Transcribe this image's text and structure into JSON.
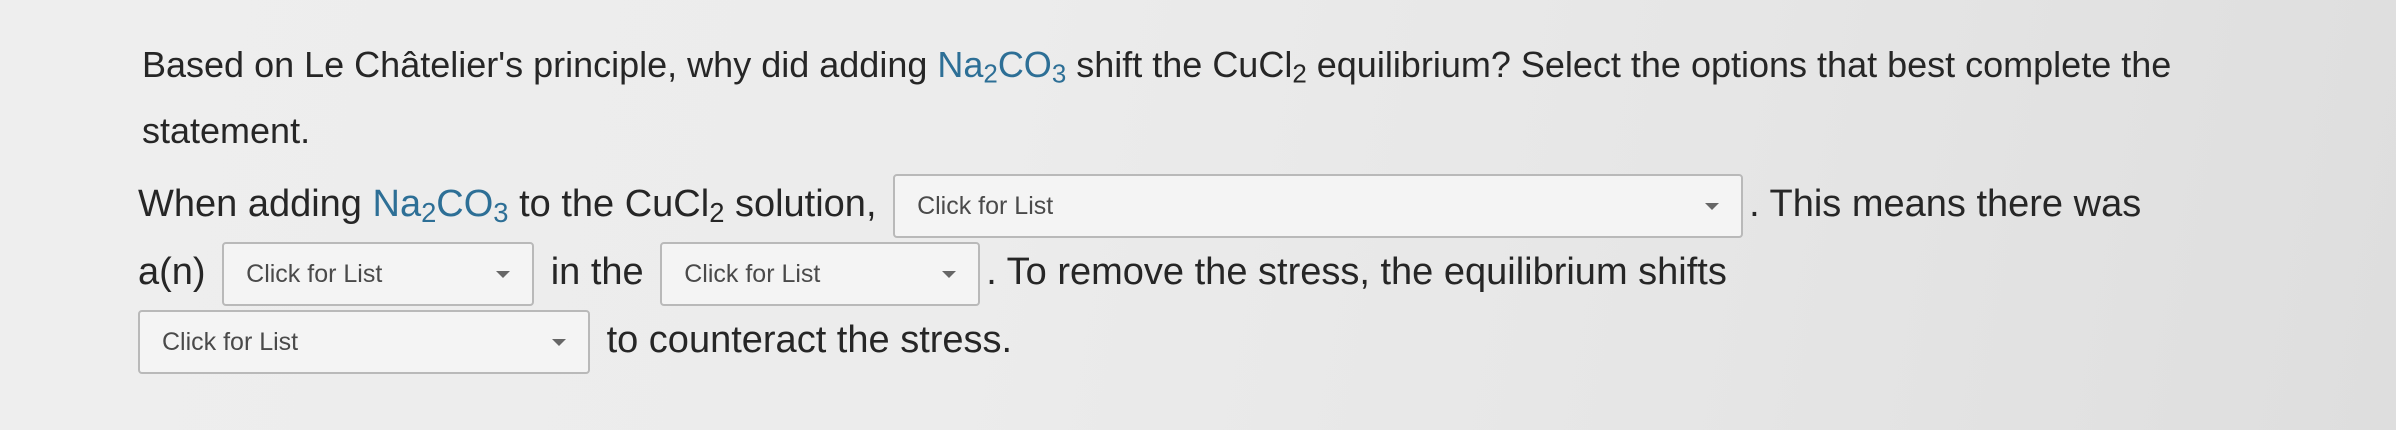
{
  "question": {
    "part1": "Based on Le Châtelier's principle, why did adding ",
    "chem1": {
      "a": "Na",
      "s1": "2",
      "b": "CO",
      "s2": "3"
    },
    "part2": " shift the ",
    "chem2": {
      "a": "CuCl",
      "s1": "2"
    },
    "part3": " equilibrium? Select the options that best complete the statement."
  },
  "statement": {
    "t1": "When adding ",
    "chemA": {
      "a": "Na",
      "s1": "2",
      "b": "CO",
      "s2": "3"
    },
    "t2": " to the ",
    "chemB": {
      "a": "CuCl",
      "s1": "2"
    },
    "t3": " solution,",
    "t4": ". This means there was",
    "t5": "a(n)",
    "t6": "in the",
    "t7": ". To remove the stress, the equilibrium shifts",
    "t8": "to counteract the stress."
  },
  "dropdowns": [
    {
      "placeholder": "Click for List"
    },
    {
      "placeholder": "Click for List"
    },
    {
      "placeholder": "Click for List"
    },
    {
      "placeholder": "Click for List"
    }
  ],
  "icons": {
    "dropdown_caret": "chevron-down-icon"
  }
}
